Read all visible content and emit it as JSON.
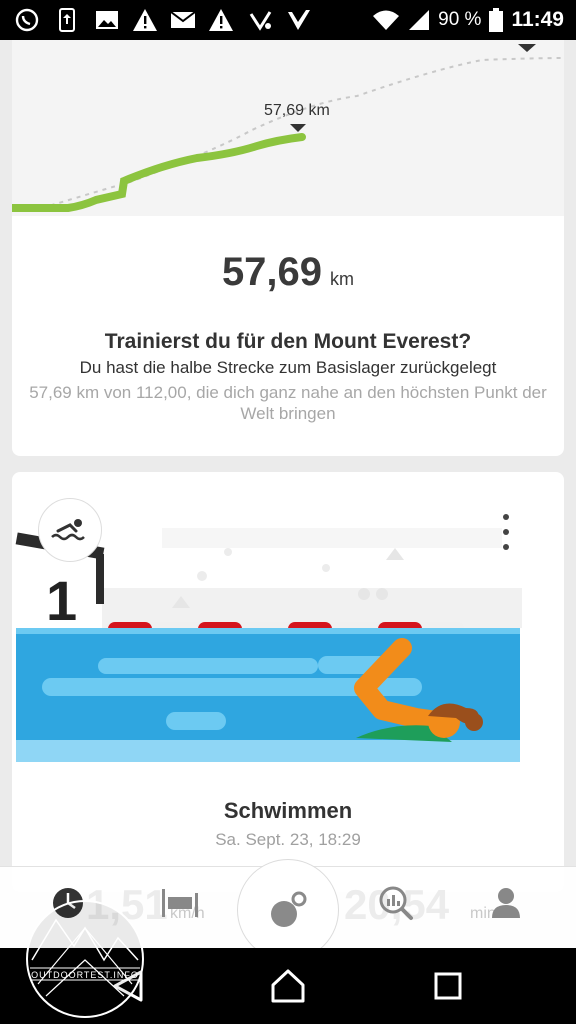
{
  "status_bar": {
    "icons": [
      "whatsapp-icon",
      "upload-icon",
      "image-icon",
      "warning-icon",
      "mail-icon",
      "warning-icon",
      "activity-icon",
      "check-icon"
    ],
    "battery_percent": "90 %",
    "time": "11:49"
  },
  "progress_card": {
    "marker_label": "57,69 km",
    "value": "57,69",
    "unit": "km",
    "title": "Trainierst du für den Mount Everest?",
    "subtitle": "Du hast die halbe Strecke zum Basislager zurückgelegt",
    "description": "57,69 km von 112,00, die dich ganz nahe an den höchsten Punkt der Welt bringen"
  },
  "activity_card": {
    "title": "Schwimmen",
    "date": "Sa. Sept. 23, 18:29",
    "lane_number": "1",
    "activity_icon": "swim-icon"
  },
  "tab_bar": {
    "ghost_left_value": "1,51",
    "ghost_left_unit": "km/h",
    "ghost_right_value": "20,54",
    "ghost_right_unit": "min",
    "tabs": [
      "clock-icon",
      "sleep-icon",
      "record-icon",
      "search-stats-icon",
      "profile-icon"
    ]
  },
  "watermark": {
    "text": "OUTDOORTEST.INFO"
  },
  "colors": {
    "progress_green": "#8cc43f",
    "water_blue": "#2fa6e0",
    "water_light": "#6ccaf2",
    "buoy_red": "#d4151d",
    "swimmer_orange": "#f28c1a"
  }
}
